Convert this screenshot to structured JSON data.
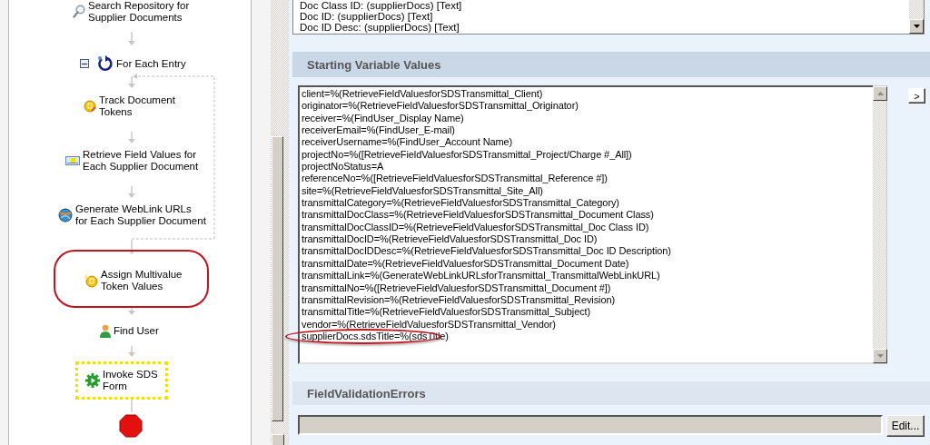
{
  "workflow": {
    "nodes": [
      {
        "kind": "search",
        "label": "Search Repository for\nSupplier Documents",
        "selected": false,
        "circled": false
      },
      {
        "kind": "loop",
        "label": "For Each Entry",
        "expanded": true,
        "selected": false,
        "circled": false
      },
      {
        "kind": "token",
        "label": "Track Document\nTokens",
        "selected": false,
        "circled": false
      },
      {
        "kind": "fields",
        "label": "Retrieve Field Values for\nEach Supplier Document",
        "selected": false,
        "circled": false
      },
      {
        "kind": "weblink",
        "label": "Generate WebLink URLs\nfor Each Supplier Document",
        "selected": false,
        "circled": false
      },
      {
        "kind": "assign",
        "label": "Assign Multivalue\nToken Values",
        "selected": false,
        "circled": true
      },
      {
        "kind": "user",
        "label": "Find User",
        "selected": false,
        "circled": false
      },
      {
        "kind": "invoke",
        "label": "Invoke SDS\nForm",
        "selected": true,
        "circled": false
      },
      {
        "kind": "stop"
      }
    ]
  },
  "token_list": {
    "items": [
      "Doc Class ID: (supplierDocs) [Text]",
      "Doc ID: (supplierDocs) [Text]",
      "Doc ID Desc: (supplierDocs) [Text]"
    ]
  },
  "starting_variable_values": {
    "title": "Starting Variable Values",
    "button": ">",
    "lines": [
      {
        "text": "client=%(RetrieveFieldValuesforSDSTransmittal_Client)",
        "circled": false
      },
      {
        "text": "originator=%(RetrieveFieldValuesforSDSTransmittal_Originator)",
        "circled": false
      },
      {
        "text": "receiver=%(FindUser_Display Name)",
        "circled": false
      },
      {
        "text": "receiverEmail=%(FindUser_E-mail)",
        "circled": false
      },
      {
        "text": "receiverUsername=%(FindUser_Account Name)",
        "circled": false
      },
      {
        "text": "projectNo=%([RetrieveFieldValuesforSDSTransmittal_Project/Charge #_All])",
        "circled": false
      },
      {
        "text": "projectNoStatus=A",
        "circled": false
      },
      {
        "text": "referenceNo=%([RetrieveFieldValuesforSDSTransmittal_Reference #])",
        "circled": false
      },
      {
        "text": "site=%(RetrieveFieldValuesforSDSTransmittal_Site_All)",
        "circled": false
      },
      {
        "text": "transmittalCategory=%(RetrieveFieldValuesforSDSTransmittal_Category)",
        "circled": false
      },
      {
        "text": "transmittalDocClass=%(RetrieveFieldValuesforSDSTransmittal_Document Class)",
        "circled": false
      },
      {
        "text": "transmittalDocClassID=%(RetrieveFieldValuesforSDSTransmittal_Doc Class ID)",
        "circled": false
      },
      {
        "text": "transmittalDocID=%(RetrieveFieldValuesforSDSTransmittal_Doc ID)",
        "circled": false
      },
      {
        "text": "transmittalDocIDDesc=%(RetrieveFieldValuesforSDSTransmittal_Doc ID Description)",
        "circled": false
      },
      {
        "text": "transmittalDate=%(RetrieveFieldValuesforSDSTransmittal_Document Date)",
        "circled": false
      },
      {
        "text": "transmittalLink=%(GenerateWebLinkURLsforTransmittal_TransmittalWebLinkURL)",
        "circled": false
      },
      {
        "text": "transmittalNo=%([RetrieveFieldValuesforSDSTransmittal_Document #])",
        "circled": false
      },
      {
        "text": "transmittalRevision=%(RetrieveFieldValuesforSDSTransmittal_Revision)",
        "circled": false
      },
      {
        "text": "transmittalTitle=%(RetrieveFieldValuesforSDSTransmittal_Subject)",
        "circled": false
      },
      {
        "text": "vendor=%(RetrieveFieldValuesforSDSTransmittal_Vendor)",
        "circled": false
      },
      {
        "text": "supplierDocs.sdsTitle=%(sdsTitle)",
        "circled": true
      }
    ]
  },
  "field_validation_errors": {
    "title": "FieldValidationErrors",
    "button": "Edit..."
  }
}
